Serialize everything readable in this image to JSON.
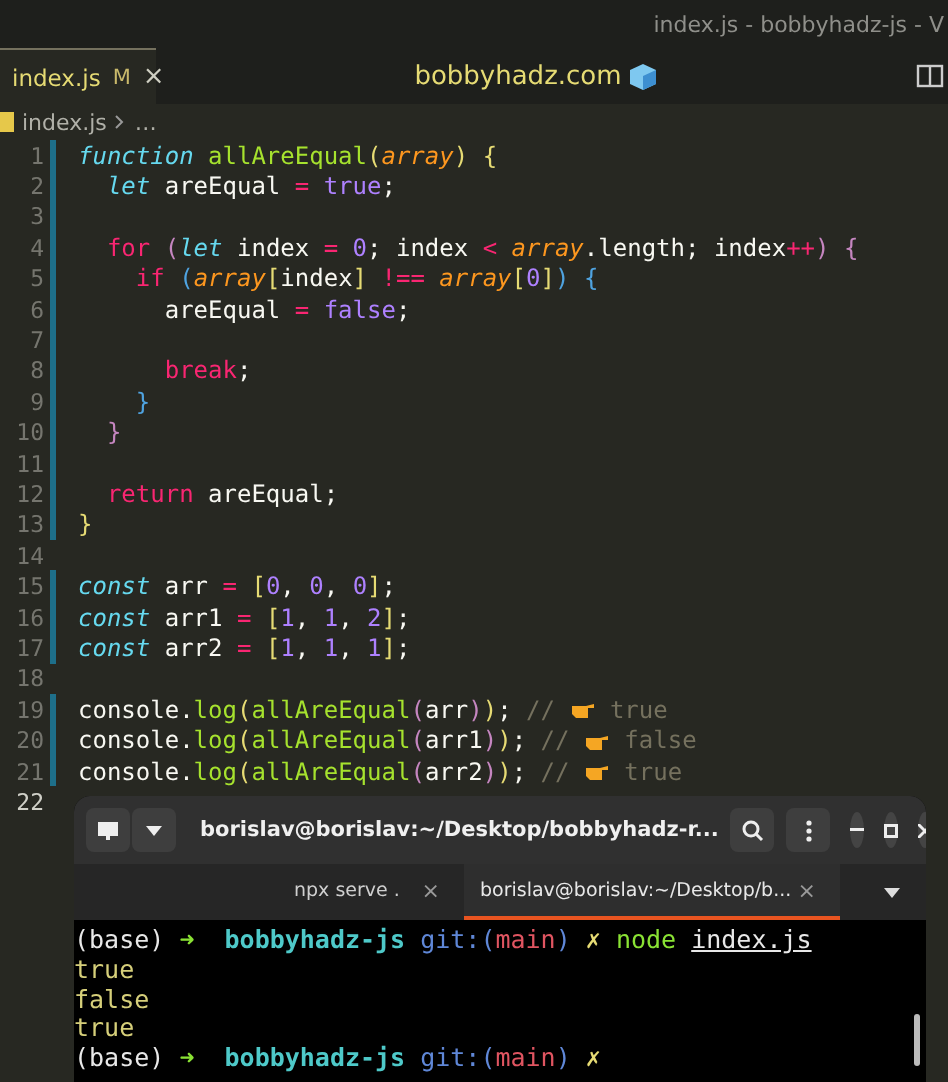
{
  "window": {
    "title": "index.js - bobbyhadz-js - V"
  },
  "tabs": [
    {
      "label": "index.js",
      "badge": "M",
      "close": "×",
      "selected": true
    }
  ],
  "watermark_title": "bobbyhadz.com",
  "breadcrumb": {
    "file": "index.js",
    "more": "…"
  },
  "editor": {
    "lines": [
      {
        "n": "1",
        "changed": true,
        "active": false,
        "tokens": [
          {
            "t": "function",
            "kind": "kw"
          },
          {
            "t": " allAreEqual",
            "kind": "fn"
          },
          {
            "t": "(",
            "kind": "b1"
          },
          {
            "t": "array",
            "kind": "param"
          },
          {
            "t": ")",
            "kind": "b1"
          },
          {
            "t": " {",
            "kind": "b1"
          }
        ]
      },
      {
        "n": "2",
        "changed": true,
        "active": false,
        "tokens": [
          {
            "t": "  let",
            "kind": "kw"
          },
          {
            "t": " areEqual "
          },
          {
            "t": "=",
            "kind": "op"
          },
          {
            "t": " true",
            "kind": "lit"
          },
          {
            "t": ";"
          }
        ]
      },
      {
        "n": "3",
        "changed": true,
        "active": false
      },
      {
        "n": "4",
        "changed": true,
        "active": false,
        "tokens": [
          {
            "t": "  for",
            "kind": "ctl"
          },
          {
            "t": " (",
            "kind": "b2"
          },
          {
            "t": "let",
            "kind": "kw"
          },
          {
            "t": " index "
          },
          {
            "t": "=",
            "kind": "op"
          },
          {
            "t": " 0",
            "kind": "lit"
          },
          {
            "t": "; index "
          },
          {
            "t": "<",
            "kind": "op"
          },
          {
            "t": " array",
            "kind": "param"
          },
          {
            "t": ".length; index"
          },
          {
            "t": "++",
            "kind": "op"
          },
          {
            "t": ")",
            "kind": "b2"
          },
          {
            "t": " {",
            "kind": "b2"
          }
        ]
      },
      {
        "n": "5",
        "changed": true,
        "active": false,
        "tokens": [
          {
            "t": "    if",
            "kind": "ctl"
          },
          {
            "t": " (",
            "kind": "b3"
          },
          {
            "t": "array",
            "kind": "param"
          },
          {
            "t": "[",
            "kind": "b1"
          },
          {
            "t": "index"
          },
          {
            "t": "]",
            "kind": "b1"
          },
          {
            "t": " !==",
            "kind": "op"
          },
          {
            "t": " array",
            "kind": "param"
          },
          {
            "t": "[",
            "kind": "b1"
          },
          {
            "t": "0",
            "kind": "lit"
          },
          {
            "t": "]",
            "kind": "b1"
          },
          {
            "t": ")",
            "kind": "b3"
          },
          {
            "t": " {",
            "kind": "b3"
          }
        ]
      },
      {
        "n": "6",
        "changed": true,
        "active": false,
        "tokens": [
          {
            "t": "      areEqual "
          },
          {
            "t": "=",
            "kind": "op"
          },
          {
            "t": " false",
            "kind": "lit"
          },
          {
            "t": ";"
          }
        ]
      },
      {
        "n": "7",
        "changed": true,
        "active": false
      },
      {
        "n": "8",
        "changed": true,
        "active": false,
        "tokens": [
          {
            "t": "      break",
            "kind": "ctl"
          },
          {
            "t": ";"
          }
        ]
      },
      {
        "n": "9",
        "changed": true,
        "active": false,
        "tokens": [
          {
            "t": "    }",
            "kind": "b3"
          }
        ]
      },
      {
        "n": "10",
        "changed": true,
        "active": false,
        "tokens": [
          {
            "t": "  }",
            "kind": "b2"
          }
        ]
      },
      {
        "n": "11",
        "changed": true,
        "active": false
      },
      {
        "n": "12",
        "changed": true,
        "active": false,
        "tokens": [
          {
            "t": "  return",
            "kind": "ctl"
          },
          {
            "t": " areEqual;"
          }
        ]
      },
      {
        "n": "13",
        "changed": true,
        "active": false,
        "tokens": [
          {
            "t": "}",
            "kind": "b1"
          }
        ]
      },
      {
        "n": "14",
        "changed": false,
        "active": false
      },
      {
        "n": "15",
        "changed": true,
        "active": false,
        "tokens": [
          {
            "t": "const",
            "kind": "kw"
          },
          {
            "t": " arr "
          },
          {
            "t": "=",
            "kind": "op"
          },
          {
            "t": " [",
            "kind": "b1"
          },
          {
            "t": "0",
            "kind": "lit"
          },
          {
            "t": ", "
          },
          {
            "t": "0",
            "kind": "lit"
          },
          {
            "t": ", "
          },
          {
            "t": "0",
            "kind": "lit"
          },
          {
            "t": "]",
            "kind": "b1"
          },
          {
            "t": ";"
          }
        ]
      },
      {
        "n": "16",
        "changed": true,
        "active": false,
        "tokens": [
          {
            "t": "const",
            "kind": "kw"
          },
          {
            "t": " arr1 "
          },
          {
            "t": "=",
            "kind": "op"
          },
          {
            "t": " [",
            "kind": "b1"
          },
          {
            "t": "1",
            "kind": "lit"
          },
          {
            "t": ", "
          },
          {
            "t": "1",
            "kind": "lit"
          },
          {
            "t": ", "
          },
          {
            "t": "2",
            "kind": "lit"
          },
          {
            "t": "]",
            "kind": "b1"
          },
          {
            "t": ";"
          }
        ]
      },
      {
        "n": "17",
        "changed": true,
        "active": false,
        "tokens": [
          {
            "t": "const",
            "kind": "kw"
          },
          {
            "t": " arr2 "
          },
          {
            "t": "=",
            "kind": "op"
          },
          {
            "t": " [",
            "kind": "b1"
          },
          {
            "t": "1",
            "kind": "lit"
          },
          {
            "t": ", "
          },
          {
            "t": "1",
            "kind": "lit"
          },
          {
            "t": ", "
          },
          {
            "t": "1",
            "kind": "lit"
          },
          {
            "t": "]",
            "kind": "b1"
          },
          {
            "t": ";"
          }
        ]
      },
      {
        "n": "18",
        "changed": false,
        "active": false
      },
      {
        "n": "19",
        "changed": true,
        "active": false,
        "tokens": [
          {
            "t": "console."
          },
          {
            "t": "log",
            "kind": "fn"
          },
          {
            "t": "(",
            "kind": "b1"
          },
          {
            "t": "allAreEqual",
            "kind": "fn"
          },
          {
            "t": "(",
            "kind": "b2"
          },
          {
            "t": "arr"
          },
          {
            "t": ")",
            "kind": "b2"
          },
          {
            "t": ")",
            "kind": "b1"
          },
          {
            "t": ";"
          },
          {
            "t": " // ",
            "kind": "cm"
          },
          {
            "kind": "hand"
          },
          {
            "t": " true",
            "kind": "cm"
          }
        ]
      },
      {
        "n": "20",
        "changed": true,
        "active": false,
        "tokens": [
          {
            "t": "console."
          },
          {
            "t": "log",
            "kind": "fn"
          },
          {
            "t": "(",
            "kind": "b1"
          },
          {
            "t": "allAreEqual",
            "kind": "fn"
          },
          {
            "t": "(",
            "kind": "b2"
          },
          {
            "t": "arr1"
          },
          {
            "t": ")",
            "kind": "b2"
          },
          {
            "t": ")",
            "kind": "b1"
          },
          {
            "t": ";"
          },
          {
            "t": " // ",
            "kind": "cm"
          },
          {
            "kind": "hand"
          },
          {
            "t": " false",
            "kind": "cm"
          }
        ]
      },
      {
        "n": "21",
        "changed": true,
        "active": false,
        "tokens": [
          {
            "t": "console."
          },
          {
            "t": "log",
            "kind": "fn"
          },
          {
            "t": "(",
            "kind": "b1"
          },
          {
            "t": "allAreEqual",
            "kind": "fn"
          },
          {
            "t": "(",
            "kind": "b2"
          },
          {
            "t": "arr2"
          },
          {
            "t": ")",
            "kind": "b2"
          },
          {
            "t": ")",
            "kind": "b1"
          },
          {
            "t": ";"
          },
          {
            "t": " // ",
            "kind": "cm"
          },
          {
            "kind": "hand"
          },
          {
            "t": " true",
            "kind": "cm"
          }
        ]
      },
      {
        "n": "22",
        "changed": false,
        "active": true
      }
    ]
  },
  "terminal": {
    "title": "borislav@borislav:~/Desktop/bobbyhadz-r...",
    "tabs": [
      {
        "label": "npx serve .",
        "close": "×",
        "selected": false
      },
      {
        "label": "borislav@borislav:~/Desktop/b...",
        "close": "×",
        "selected": true
      }
    ],
    "lines": [
      {
        "tokens": [
          {
            "t": "(base) "
          },
          {
            "t": "➜",
            "kind": "arrow"
          },
          {
            "t": "  bobbyhadz-js",
            "kind": "dir"
          },
          {
            "t": " git:(",
            "kind": "git"
          },
          {
            "t": "main",
            "kind": "branch"
          },
          {
            "t": ")",
            "kind": "git"
          },
          {
            "t": " ✗ ",
            "kind": "x"
          },
          {
            "t": "node ",
            "kind": "cmd"
          },
          {
            "t": "index.js",
            "kind": "ul"
          }
        ]
      },
      {
        "tokens": [
          {
            "t": "true",
            "kind": "out"
          }
        ]
      },
      {
        "tokens": [
          {
            "t": "false",
            "kind": "out"
          }
        ]
      },
      {
        "tokens": [
          {
            "t": "true",
            "kind": "out"
          }
        ]
      },
      {
        "tokens": [
          {
            "t": "(base) "
          },
          {
            "t": "➜",
            "kind": "arrow"
          },
          {
            "t": "  bobbyhadz-js",
            "kind": "dir"
          },
          {
            "t": " git:(",
            "kind": "git"
          },
          {
            "t": "main",
            "kind": "branch"
          },
          {
            "t": ")",
            "kind": "git"
          },
          {
            "t": " ✗",
            "kind": "x"
          }
        ]
      }
    ]
  }
}
